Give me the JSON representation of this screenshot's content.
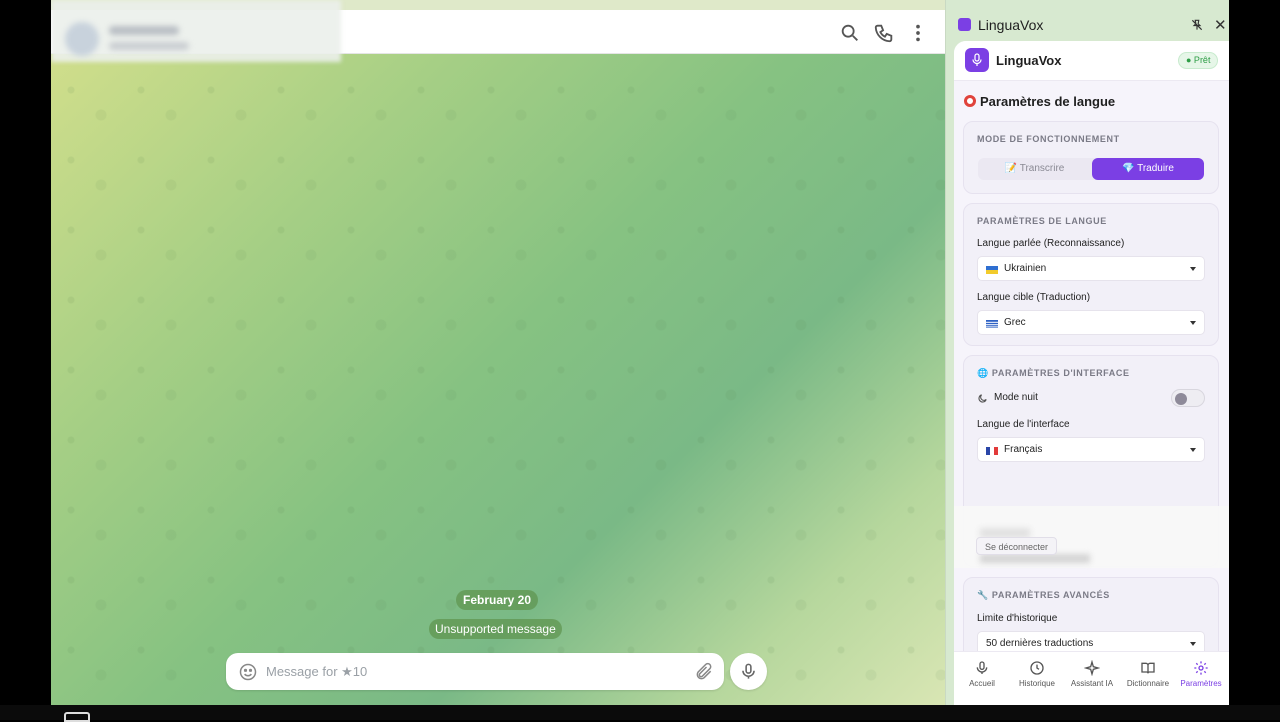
{
  "chat": {
    "date_label": "February 20",
    "system_message": "Unsupported message",
    "composer_placeholder": "Message for ★10"
  },
  "panel": {
    "window_title": "LinguaVox",
    "app_name": "LinguaVox",
    "status_badge": "● Prêt",
    "section_title": "Paramètres de langue",
    "mode_card": {
      "label": "MODE DE FONCTIONNEMENT",
      "transcribe_label": "📝 Transcrire",
      "translate_label": "💎 Traduire",
      "active": "translate"
    },
    "language_card": {
      "label": "PARAMÈTRES DE LANGUE",
      "spoken_label": "Langue parlée (Reconnaissance)",
      "spoken_value": "Ukrainien",
      "target_label": "Langue cible (Traduction)",
      "target_value": "Grec"
    },
    "interface_card": {
      "label": "🌐 PARAMÈTRES D'INTERFACE",
      "night_mode_label": "Mode nuit",
      "night_mode_on": false,
      "ui_language_label": "Langue de l'interface",
      "ui_language_value": "Français"
    },
    "account_card": {
      "logout_label": "Se déconnecter"
    },
    "advanced_card": {
      "label": "🔧 PARAMÈTRES AVANCÉS",
      "history_limit_label": "Limite d'historique",
      "history_limit_value": "50 dernières traductions"
    },
    "nav": [
      {
        "label": "Accueil",
        "icon": "mic-icon"
      },
      {
        "label": "Historique",
        "icon": "clock-icon"
      },
      {
        "label": "Assistant IA",
        "icon": "sparkle-icon"
      },
      {
        "label": "Dictionnaire",
        "icon": "book-icon"
      },
      {
        "label": "Paramètres",
        "icon": "gear-icon",
        "active": true
      }
    ]
  },
  "colors": {
    "accent": "#7b3fe4",
    "ready_green": "#2e9d46",
    "chat_pill": "#6a9a55"
  }
}
